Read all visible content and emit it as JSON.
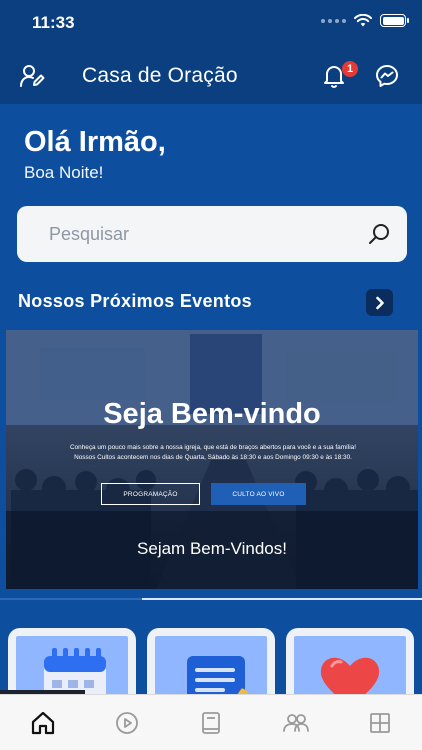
{
  "status_bar": {
    "time": "11:33"
  },
  "header": {
    "title": "Casa de Oração",
    "notification_count": "1",
    "icons": {
      "left": "profile-edit-icon",
      "bell": "bell-icon",
      "messenger": "messenger-icon"
    }
  },
  "greeting": {
    "title": "Olá Irmão,",
    "subtitle": "Boa Noite!"
  },
  "search": {
    "placeholder": "Pesquisar"
  },
  "events": {
    "title": "Nossos Próximos Eventos",
    "banner": {
      "heading": "Seja Bem-vindo",
      "text": "Conheça um pouco mais sobre a nossa igreja, que está de braços abertos para você e a sua família! Nossos Cultos acontecem nos dias de Quarta, Sábado às 18:30 e aos Domingo 09:30 e às 18:30.",
      "button_program": "PROGRAMAÇÃO",
      "button_live": "CULTO AO VIVO",
      "caption": "Sejam Bem-Vindos!"
    }
  },
  "colors": {
    "primary": "#0d4f9e",
    "header": "#0b3f80",
    "badge": "#e53935",
    "accent": "#1f5fb5"
  },
  "tabs": [
    {
      "name": "home",
      "icon": "home-icon"
    },
    {
      "name": "videos",
      "icon": "play-icon"
    },
    {
      "name": "bible",
      "icon": "book-icon"
    },
    {
      "name": "community",
      "icon": "people-icon"
    },
    {
      "name": "more",
      "icon": "grid-icon"
    }
  ]
}
